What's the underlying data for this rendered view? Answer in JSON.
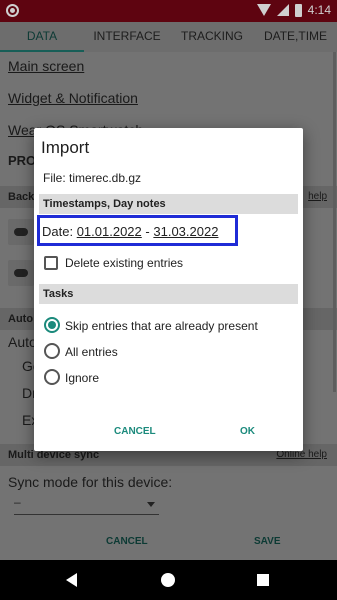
{
  "status_bar": {
    "time": "4:14"
  },
  "tabs": [
    {
      "label": "DATA",
      "active": true
    },
    {
      "label": "INTERFACE",
      "active": false
    },
    {
      "label": "TRACKING",
      "active": false
    },
    {
      "label": "DATE,TIME",
      "active": false
    }
  ],
  "background": {
    "links": [
      "Main screen",
      "Widget & Notification",
      "Wear OS Smartwatch"
    ],
    "pro_heading": "PRO",
    "backup_section": "Back",
    "backup_help": "help",
    "auto_section": "Auto",
    "auto_label": "Auto",
    "auto_sub": [
      "Go",
      "Dr",
      "Ex"
    ],
    "multi_section": "Multi device sync",
    "multi_help": "Online help",
    "sync_label": "Sync mode for this device:",
    "sync_value": "–",
    "cancel": "CANCEL",
    "save": "SAVE"
  },
  "dialog": {
    "title": "Import",
    "file": "File: timerec.db.gz",
    "section_timestamps": "Timestamps, Day notes",
    "date_label": "Date:",
    "date_from": "01.01.2022",
    "date_sep": "-",
    "date_to": "31.03.2022",
    "delete_label": "Delete existing entries",
    "delete_checked": false,
    "section_tasks": "Tasks",
    "task_options": [
      {
        "label": "Skip entries that are already present",
        "selected": true
      },
      {
        "label": "All entries",
        "selected": false
      },
      {
        "label": "Ignore",
        "selected": false
      }
    ],
    "cancel": "CANCEL",
    "ok": "OK"
  },
  "colors": {
    "accent": "#1b8a7c",
    "highlight_box": "#1f2bd6",
    "status_bar": "#5e0410"
  }
}
